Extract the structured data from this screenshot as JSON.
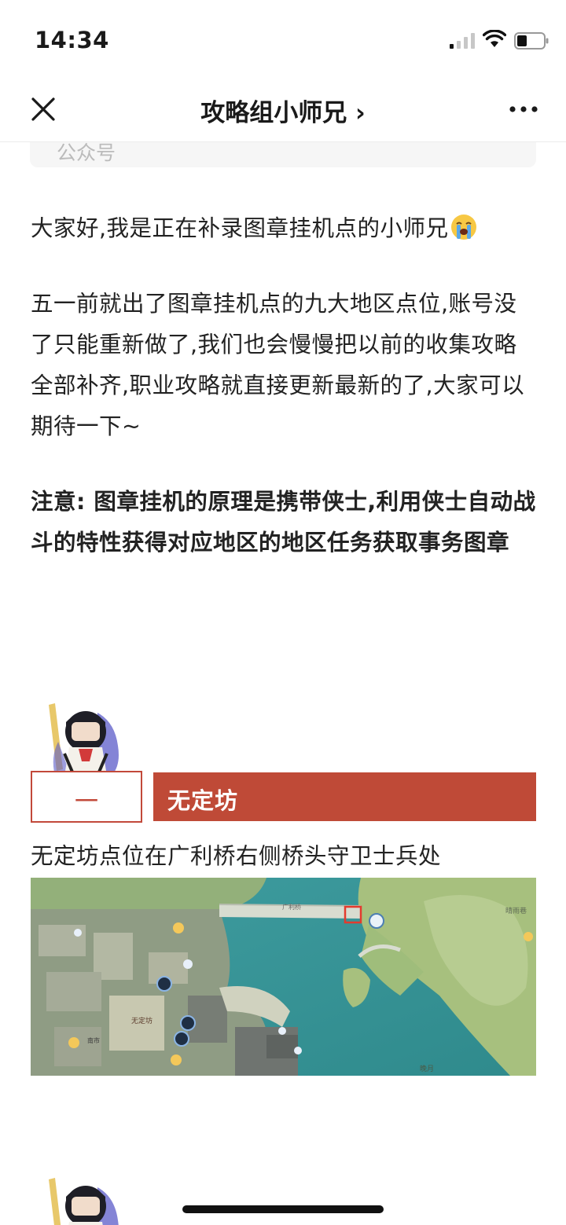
{
  "status_bar": {
    "time": "14:34"
  },
  "navbar": {
    "title": "攻略组小师兄 ›"
  },
  "top_card": {
    "label": "公众号"
  },
  "article": {
    "intro": "大家好,我是正在补录图章挂机点的小师兄",
    "intro_emoji": "crying-face-emoji",
    "body": "五一前就出了图章挂机点的九大地区点位,账号没了只能重新做了,我们也会慢慢把以前的收集攻略全部补齐,职业攻略就直接更新最新的了,大家可以期待一下~",
    "note": "注意: 图章挂机的原理是携带侠士,利用侠士自动战斗的特性获得对应地区的地区任务获取事务图章"
  },
  "section": {
    "number": "一",
    "title": "无定坊",
    "caption": "无定坊点位在广利桥右侧桥头守卫士兵处",
    "colors": {
      "accent": "#bf4a37"
    }
  },
  "map": {
    "labels": [
      "晴雨巷",
      "广利桥",
      "无定坊",
      "晚月",
      "南市"
    ]
  }
}
